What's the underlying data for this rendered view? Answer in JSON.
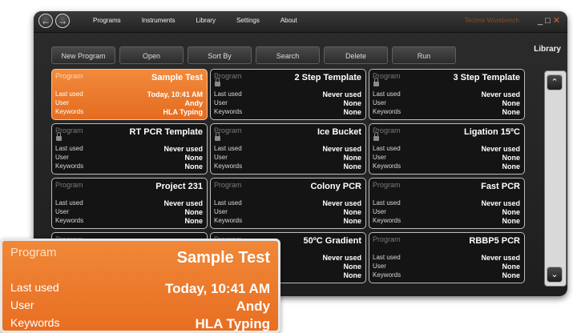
{
  "menu": [
    "Programs",
    "Instruments",
    "Library",
    "Settings",
    "About"
  ],
  "brand": "Techne Workbench",
  "toolbar": [
    "New Program",
    "Open",
    "Sort By",
    "Search",
    "Delete",
    "Run"
  ],
  "panel_title": "Library",
  "field_labels": {
    "header": "Program",
    "last_used": "Last used",
    "user": "User",
    "keywords": "Keywords"
  },
  "programs": [
    {
      "name": "Sample Test",
      "last_used": "Today, 10:41 AM",
      "user": "Andy",
      "keywords": "HLA Typing",
      "selected": true,
      "locked": false
    },
    {
      "name": "2 Step Template",
      "last_used": "Never used",
      "user": "None",
      "keywords": "None",
      "selected": false,
      "locked": true
    },
    {
      "name": "3 Step Template",
      "last_used": "Never used",
      "user": "None",
      "keywords": "None",
      "selected": false,
      "locked": true
    },
    {
      "name": "RT PCR Template",
      "last_used": "Never used",
      "user": "None",
      "keywords": "None",
      "selected": false,
      "locked": true
    },
    {
      "name": "Ice Bucket",
      "last_used": "Never used",
      "user": "None",
      "keywords": "None",
      "selected": false,
      "locked": true
    },
    {
      "name": "Ligation 15ºC",
      "last_used": "Never used",
      "user": "None",
      "keywords": "None",
      "selected": false,
      "locked": true
    },
    {
      "name": "Project 231",
      "last_used": "Never used",
      "user": "None",
      "keywords": "None",
      "selected": false,
      "locked": false
    },
    {
      "name": "Colony PCR",
      "last_used": "Never used",
      "user": "None",
      "keywords": "None",
      "selected": false,
      "locked": false
    },
    {
      "name": "Fast PCR",
      "last_used": "Never used",
      "user": "None",
      "keywords": "None",
      "selected": false,
      "locked": false
    },
    {
      "name": "",
      "last_used": "",
      "user": "",
      "keywords": "",
      "selected": false,
      "locked": false
    },
    {
      "name": "50ºC Gradient",
      "last_used": "Never used",
      "user": "None",
      "keywords": "None",
      "selected": false,
      "locked": false
    },
    {
      "name": "RBBP5 PCR",
      "last_used": "Never used",
      "user": "None",
      "keywords": "None",
      "selected": false,
      "locked": false
    }
  ],
  "zoom_callout": {
    "header": "Program",
    "name": "Sample Test",
    "last_used": "Today, 10:41 AM",
    "user": "Andy",
    "keywords": "HLA Typing"
  },
  "colors": {
    "accent": "#e8762a",
    "background": "#1e1e1e"
  }
}
